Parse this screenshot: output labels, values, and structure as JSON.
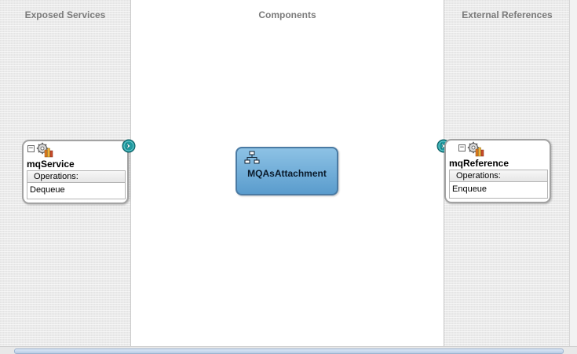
{
  "lanes": {
    "exposed_services": "Exposed Services",
    "components": "Components",
    "external_references": "External References"
  },
  "service": {
    "name": "mqService",
    "operations_label": "Operations:",
    "operations": [
      "Dequeue"
    ],
    "collapse_symbol": "−"
  },
  "component": {
    "name": "MQAsAttachment"
  },
  "reference": {
    "name": "mqReference",
    "operations_label": "Operations:",
    "operations": [
      "Enqueue"
    ],
    "collapse_symbol": "−"
  },
  "colors": {
    "component_fill": "#6aa9d6",
    "port_teal": "#1f9aa0",
    "lane_title": "#7a7a7a"
  },
  "icons": {
    "service_type": "gear-adapter-icon",
    "component_type": "bpel-flow-icon",
    "port": "wire-port-icon"
  }
}
